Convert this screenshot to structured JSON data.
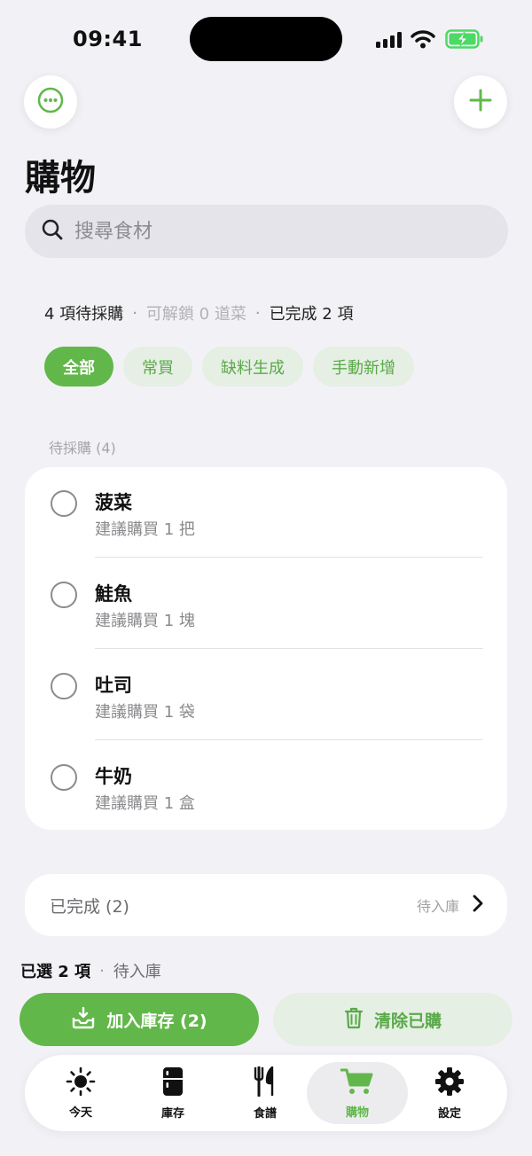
{
  "status_bar": {
    "time": "09:41"
  },
  "page": {
    "title": "購物"
  },
  "search": {
    "placeholder": "搜尋食材"
  },
  "summary": {
    "pending": "4 項待採購",
    "unlock": "可解鎖 0 道菜",
    "completed": "已完成 2 項",
    "separator": "·"
  },
  "filters": [
    {
      "label": "全部",
      "active": true
    },
    {
      "label": "常買",
      "active": false
    },
    {
      "label": "缺料生成",
      "active": false
    },
    {
      "label": "手動新增",
      "active": false
    }
  ],
  "pending_section": {
    "label": "待採購 (4)",
    "items": [
      {
        "name": "菠菜",
        "suggestion": "建議購買 1 把"
      },
      {
        "name": "鮭魚",
        "suggestion": "建議購買 1 塊"
      },
      {
        "name": "吐司",
        "suggestion": "建議購買 1 袋"
      },
      {
        "name": "牛奶",
        "suggestion": "建議購買 1 盒"
      }
    ]
  },
  "completed_section": {
    "label": "已完成 (2)",
    "status": "待入庫"
  },
  "selection": {
    "count": "已選 2 項",
    "status": "待入庫",
    "separator": "·"
  },
  "actions": {
    "add_to_inventory": "加入庫存 (2)",
    "clear_purchased": "清除已購"
  },
  "tabs": [
    {
      "label": "今天",
      "icon": "sun-icon",
      "active": false
    },
    {
      "label": "庫存",
      "icon": "fridge-icon",
      "active": false
    },
    {
      "label": "食譜",
      "icon": "fork-knife-icon",
      "active": false
    },
    {
      "label": "購物",
      "icon": "cart-icon",
      "active": true
    },
    {
      "label": "設定",
      "icon": "gear-icon",
      "active": false
    }
  ],
  "colors": {
    "accent": "#62b74a",
    "accent_light": "#e5efe3",
    "background": "#f2f2f6",
    "battery_charging": "#4cd964"
  }
}
